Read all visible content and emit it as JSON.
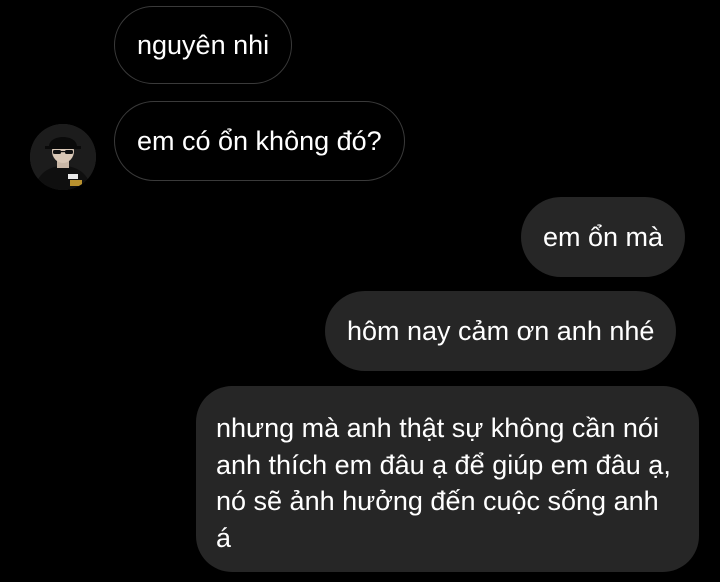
{
  "conversation": {
    "messages": [
      {
        "direction": "incoming",
        "text": "nguyên nhi"
      },
      {
        "direction": "incoming",
        "text": "em có ổn không đó?"
      },
      {
        "direction": "outgoing",
        "text": "em ổn mà"
      },
      {
        "direction": "outgoing",
        "text": "hôm nay cảm ơn anh nhé"
      },
      {
        "direction": "outgoing",
        "text": "nhưng mà anh thật sự không cần nói anh thích em đâu ạ để giúp em đâu ạ, nó sẽ ảnh hưởng đến cuộc sống anh á"
      }
    ]
  },
  "colors": {
    "background": "#000000",
    "incoming_border": "#3a3a3a",
    "outgoing_bubble": "#262626",
    "text": "#ffffff"
  },
  "icons": {
    "avatar": "contact-avatar-photo"
  }
}
